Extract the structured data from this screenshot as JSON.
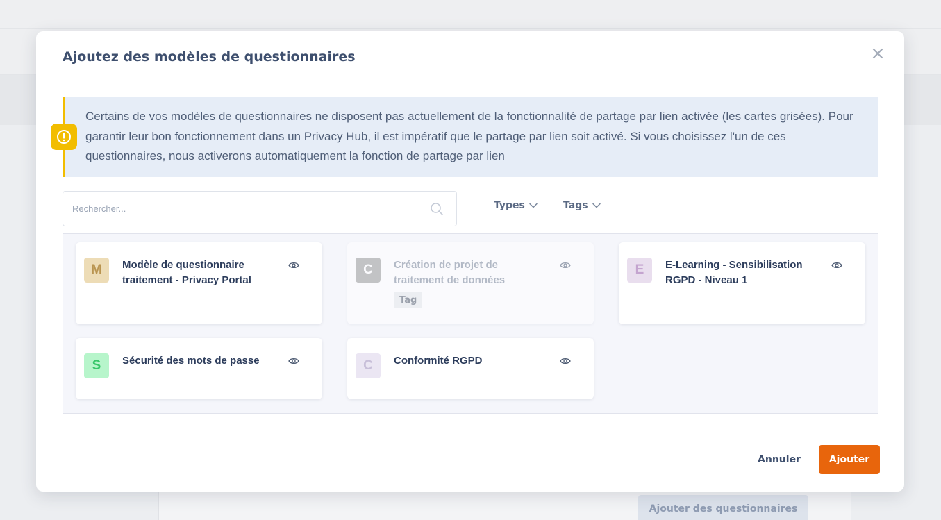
{
  "background": {
    "add_questionnaires_button": "Ajouter des questionnaires"
  },
  "modal": {
    "title": "Ajoutez des modèles de questionnaires",
    "close_icon": "close-icon",
    "alert": {
      "icon": "warning-circle-icon",
      "text": "Certains de vos modèles de questionnaires ne disposent pas actuellement de la fonctionnalité de partage par lien activée (les cartes grisées). Pour garantir leur bon fonctionnement dans un Privacy Hub, il est impératif que le partage par lien soit activé. Si vous choisissez l'un de ces questionnaires, nous activerons automatiquement la fonction de partage par lien"
    },
    "search": {
      "placeholder": "Rechercher...",
      "value": ""
    },
    "filters": {
      "types_label": "Types",
      "tags_label": "Tags"
    },
    "cards": [
      {
        "letter": "M",
        "title": "Modèle de questionnaire traitement - Privacy Portal",
        "avatar_bg": "#eddcb6",
        "avatar_fg": "#b99450",
        "disabled": false,
        "tag": ""
      },
      {
        "letter": "C",
        "title": "Création de projet de traitement de données",
        "avatar_bg": "#9a9a9a",
        "avatar_fg": "#ffffff",
        "disabled": true,
        "tag": "Tag"
      },
      {
        "letter": "E",
        "title": "E-Learning - Sensibilisation RGPD - Niveau 1",
        "avatar_bg": "#e9deee",
        "avatar_fg": "#c4a4cf",
        "disabled": false,
        "tag": ""
      },
      {
        "letter": "S",
        "title": "Sécurité des mots de passe",
        "avatar_bg": "#b7f5cb",
        "avatar_fg": "#38c76a",
        "disabled": false,
        "tag": ""
      },
      {
        "letter": "C",
        "title": "Conformité RGPD",
        "avatar_bg": "#ebe6f3",
        "avatar_fg": "#c8bfd9",
        "disabled": false,
        "tag": ""
      }
    ],
    "footer": {
      "cancel_label": "Annuler",
      "add_label": "Ajouter"
    },
    "colors": {
      "primary": "#e8650c",
      "alert_bg": "#e6edf7",
      "alert_accent": "#f2bd00"
    }
  }
}
